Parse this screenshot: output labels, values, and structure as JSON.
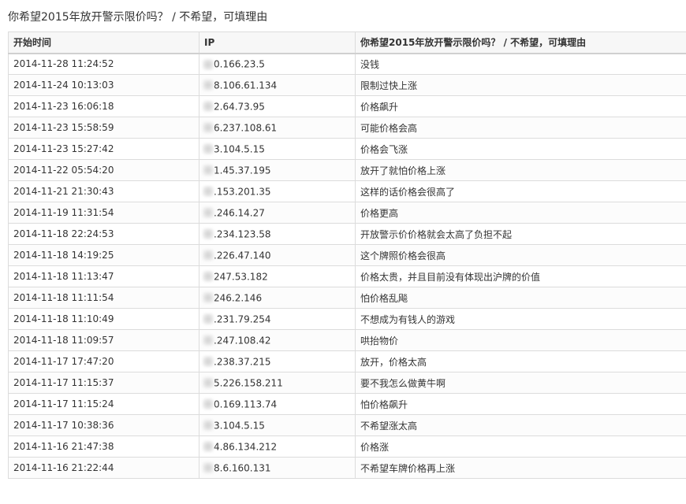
{
  "page": {
    "title": "你希望2015年放开警示限价吗？ / 不希望，可填理由"
  },
  "table": {
    "headers": [
      "开始时间",
      "IP",
      "你希望2015年放开警示限价吗？ / 不希望，可填理由"
    ],
    "rows": [
      [
        "2014-11-28 11:24:52",
        "0.166.23.5",
        "没钱"
      ],
      [
        "2014-11-24 10:13:03",
        "8.106.61.134",
        "限制过快上涨"
      ],
      [
        "2014-11-23 16:06:18",
        "2.64.73.95",
        "价格飙升"
      ],
      [
        "2014-11-23 15:58:59",
        "6.237.108.61",
        "可能价格会高"
      ],
      [
        "2014-11-23 15:27:42",
        "3.104.5.15",
        "价格会飞涨"
      ],
      [
        "2014-11-22 05:54:20",
        "1.45.37.195",
        "放开了就怕价格上涨"
      ],
      [
        "2014-11-21 21:30:43",
        ".153.201.35",
        "这样的话价格会很高了"
      ],
      [
        "2014-11-19 11:31:54",
        ".246.14.27",
        "价格更高"
      ],
      [
        "2014-11-18 22:24:53",
        ".234.123.58",
        "开放警示价价格就会太高了负担不起"
      ],
      [
        "2014-11-18 14:19:25",
        ".226.47.140",
        "这个牌照价格会很高"
      ],
      [
        "2014-11-18 11:13:47",
        "247.53.182",
        "价格太贵，并且目前没有体现出沪牌的价值"
      ],
      [
        "2014-11-18 11:11:54",
        "246.2.146",
        "怕价格乱飚"
      ],
      [
        "2014-11-18 11:10:49",
        ".231.79.254",
        "不想成为有钱人的游戏"
      ],
      [
        "2014-11-18 11:09:57",
        ".247.108.42",
        "哄抬物价"
      ],
      [
        "2014-11-17 17:47:20",
        ".238.37.215",
        "放开，价格太高"
      ],
      [
        "2014-11-17 11:15:37",
        "5.226.158.211",
        "要不我怎么做黄牛啊"
      ],
      [
        "2014-11-17 11:15:24",
        "0.169.113.74",
        "怕价格飙升"
      ],
      [
        "2014-11-17 10:38:36",
        "3.104.5.15",
        "不希望涨太高"
      ],
      [
        "2014-11-16 21:47:38",
        "4.86.134.212",
        "价格涨"
      ],
      [
        "2014-11-16 21:22:44",
        "8.6.160.131",
        "不希望车牌价格再上涨"
      ]
    ]
  }
}
